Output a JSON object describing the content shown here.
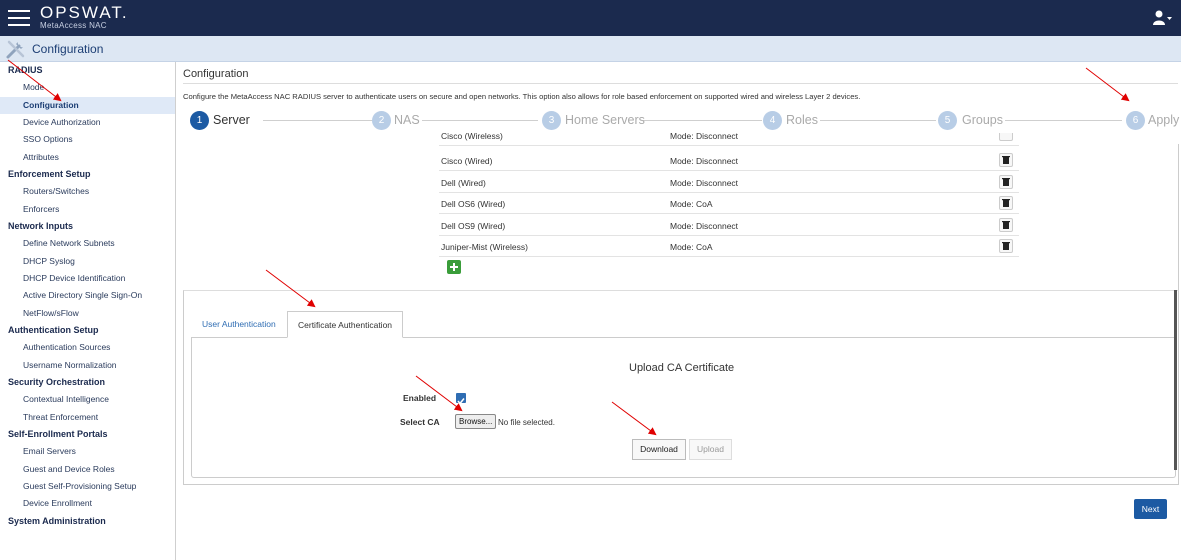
{
  "topbar": {
    "logo": "OPSWAT.",
    "logo_sub": "MetaAccess NAC",
    "menu_icon": "hamburger-icon",
    "user_icon": "user-icon"
  },
  "subbar": {
    "title": "Configuration",
    "icon": "tools-icon"
  },
  "sidebar": {
    "items": [
      {
        "label": "RADIUS",
        "type": "head"
      },
      {
        "label": "Mode",
        "type": "link"
      },
      {
        "label": "Configuration",
        "type": "link",
        "active": true
      },
      {
        "label": "Device Authorization",
        "type": "link"
      },
      {
        "label": "SSO Options",
        "type": "link"
      },
      {
        "label": "Attributes",
        "type": "link"
      },
      {
        "label": "Enforcement Setup",
        "type": "head"
      },
      {
        "label": "Routers/Switches",
        "type": "link"
      },
      {
        "label": "Enforcers",
        "type": "link"
      },
      {
        "label": "Network Inputs",
        "type": "head"
      },
      {
        "label": "Define Network Subnets",
        "type": "link"
      },
      {
        "label": "DHCP Syslog",
        "type": "link"
      },
      {
        "label": "DHCP Device Identification",
        "type": "link"
      },
      {
        "label": "Active Directory Single Sign-On",
        "type": "link"
      },
      {
        "label": "NetFlow/sFlow",
        "type": "link"
      },
      {
        "label": "Authentication Setup",
        "type": "head"
      },
      {
        "label": "Authentication Sources",
        "type": "link"
      },
      {
        "label": "Username Normalization",
        "type": "link"
      },
      {
        "label": "Security Orchestration",
        "type": "head"
      },
      {
        "label": "Contextual Intelligence",
        "type": "link"
      },
      {
        "label": "Threat Enforcement",
        "type": "link"
      },
      {
        "label": "Self-Enrollment Portals",
        "type": "head"
      },
      {
        "label": "Email Servers",
        "type": "link"
      },
      {
        "label": "Guest and Device Roles",
        "type": "link"
      },
      {
        "label": "Guest Self-Provisioning Setup",
        "type": "link"
      },
      {
        "label": "Device Enrollment",
        "type": "link"
      },
      {
        "label": "System Administration",
        "type": "head"
      }
    ]
  },
  "main": {
    "title": "Configuration",
    "description": "Configure the MetaAccess NAC RADIUS server to authenticate users on secure and open networks. This option also allows for role based enforcement on supported wired and wireless Layer 2 devices.",
    "steps": [
      {
        "num": "1",
        "label": "Server",
        "active": true
      },
      {
        "num": "2",
        "label": "NAS"
      },
      {
        "num": "3",
        "label": "Home Servers"
      },
      {
        "num": "4",
        "label": "Roles"
      },
      {
        "num": "5",
        "label": "Groups"
      },
      {
        "num": "6",
        "label": "Apply"
      }
    ],
    "nas_rows": [
      {
        "name": "Cisco (Wireless)",
        "mode": "Mode: Disconnect"
      },
      {
        "name": "Cisco (Wired)",
        "mode": "Mode: Disconnect"
      },
      {
        "name": "Dell (Wired)",
        "mode": "Mode: Disconnect"
      },
      {
        "name": "Dell OS6 (Wired)",
        "mode": "Mode: CoA"
      },
      {
        "name": "Dell OS9 (Wired)",
        "mode": "Mode: Disconnect"
      },
      {
        "name": "Juniper-Mist (Wireless)",
        "mode": "Mode: CoA"
      }
    ],
    "tabs": {
      "user": "User Authentication",
      "cert": "Certificate Authentication"
    },
    "cert": {
      "title": "Upload CA Certificate",
      "enabled_label": "Enabled",
      "enabled": true,
      "select_ca_label": "Select CA",
      "browse_label": "Browse...",
      "no_file": "No file selected.",
      "download_label": "Download",
      "upload_label": "Upload"
    },
    "next_label": "Next"
  },
  "colors": {
    "navbar": "#1b2a4e",
    "accent": "#1c5aa3",
    "annotation": "#e00000"
  }
}
